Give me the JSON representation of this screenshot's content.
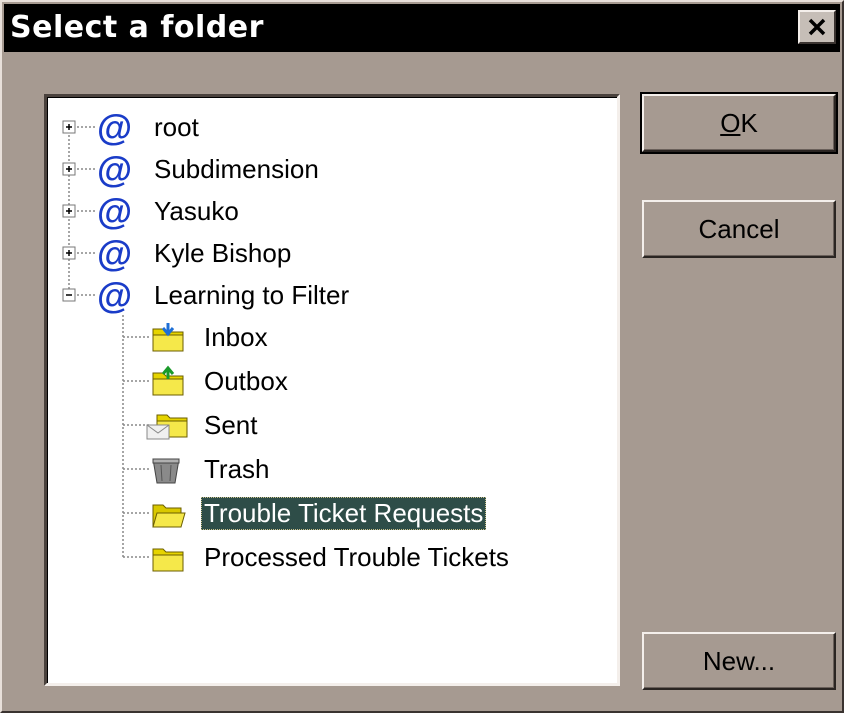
{
  "dialog": {
    "title": "Select a folder",
    "close_symbol": "×"
  },
  "buttons": {
    "ok_mnemonic": "O",
    "ok_rest": "K",
    "cancel": "Cancel",
    "new": "New..."
  },
  "tree": {
    "accounts": [
      {
        "label": "root",
        "icon": "at-sign-icon",
        "expander": "+"
      },
      {
        "label": "Subdimension",
        "icon": "at-sign-icon",
        "expander": "+"
      },
      {
        "label": "Yasuko",
        "icon": "at-sign-icon",
        "expander": "+"
      },
      {
        "label": "Kyle Bishop",
        "icon": "at-sign-icon",
        "expander": "+"
      },
      {
        "label": "Learning to Filter",
        "icon": "at-sign-icon",
        "expander": "-"
      }
    ],
    "folders": [
      {
        "label": "Inbox",
        "icon": "inbox-folder-icon"
      },
      {
        "label": "Outbox",
        "icon": "outbox-folder-icon"
      },
      {
        "label": "Sent",
        "icon": "sent-folder-icon"
      },
      {
        "label": "Trash",
        "icon": "trash-icon"
      },
      {
        "label": "Trouble Ticket Requests",
        "icon": "open-folder-icon",
        "selected": true
      },
      {
        "label": "Processed Trouble Tickets",
        "icon": "folder-icon"
      }
    ]
  },
  "colors": {
    "dialog_bg": "#a69a91",
    "title_bg": "#000000",
    "selection_bg": "#2e4d48",
    "at_icon": "#1a3cc8",
    "folder_yellow": "#e6d400"
  }
}
